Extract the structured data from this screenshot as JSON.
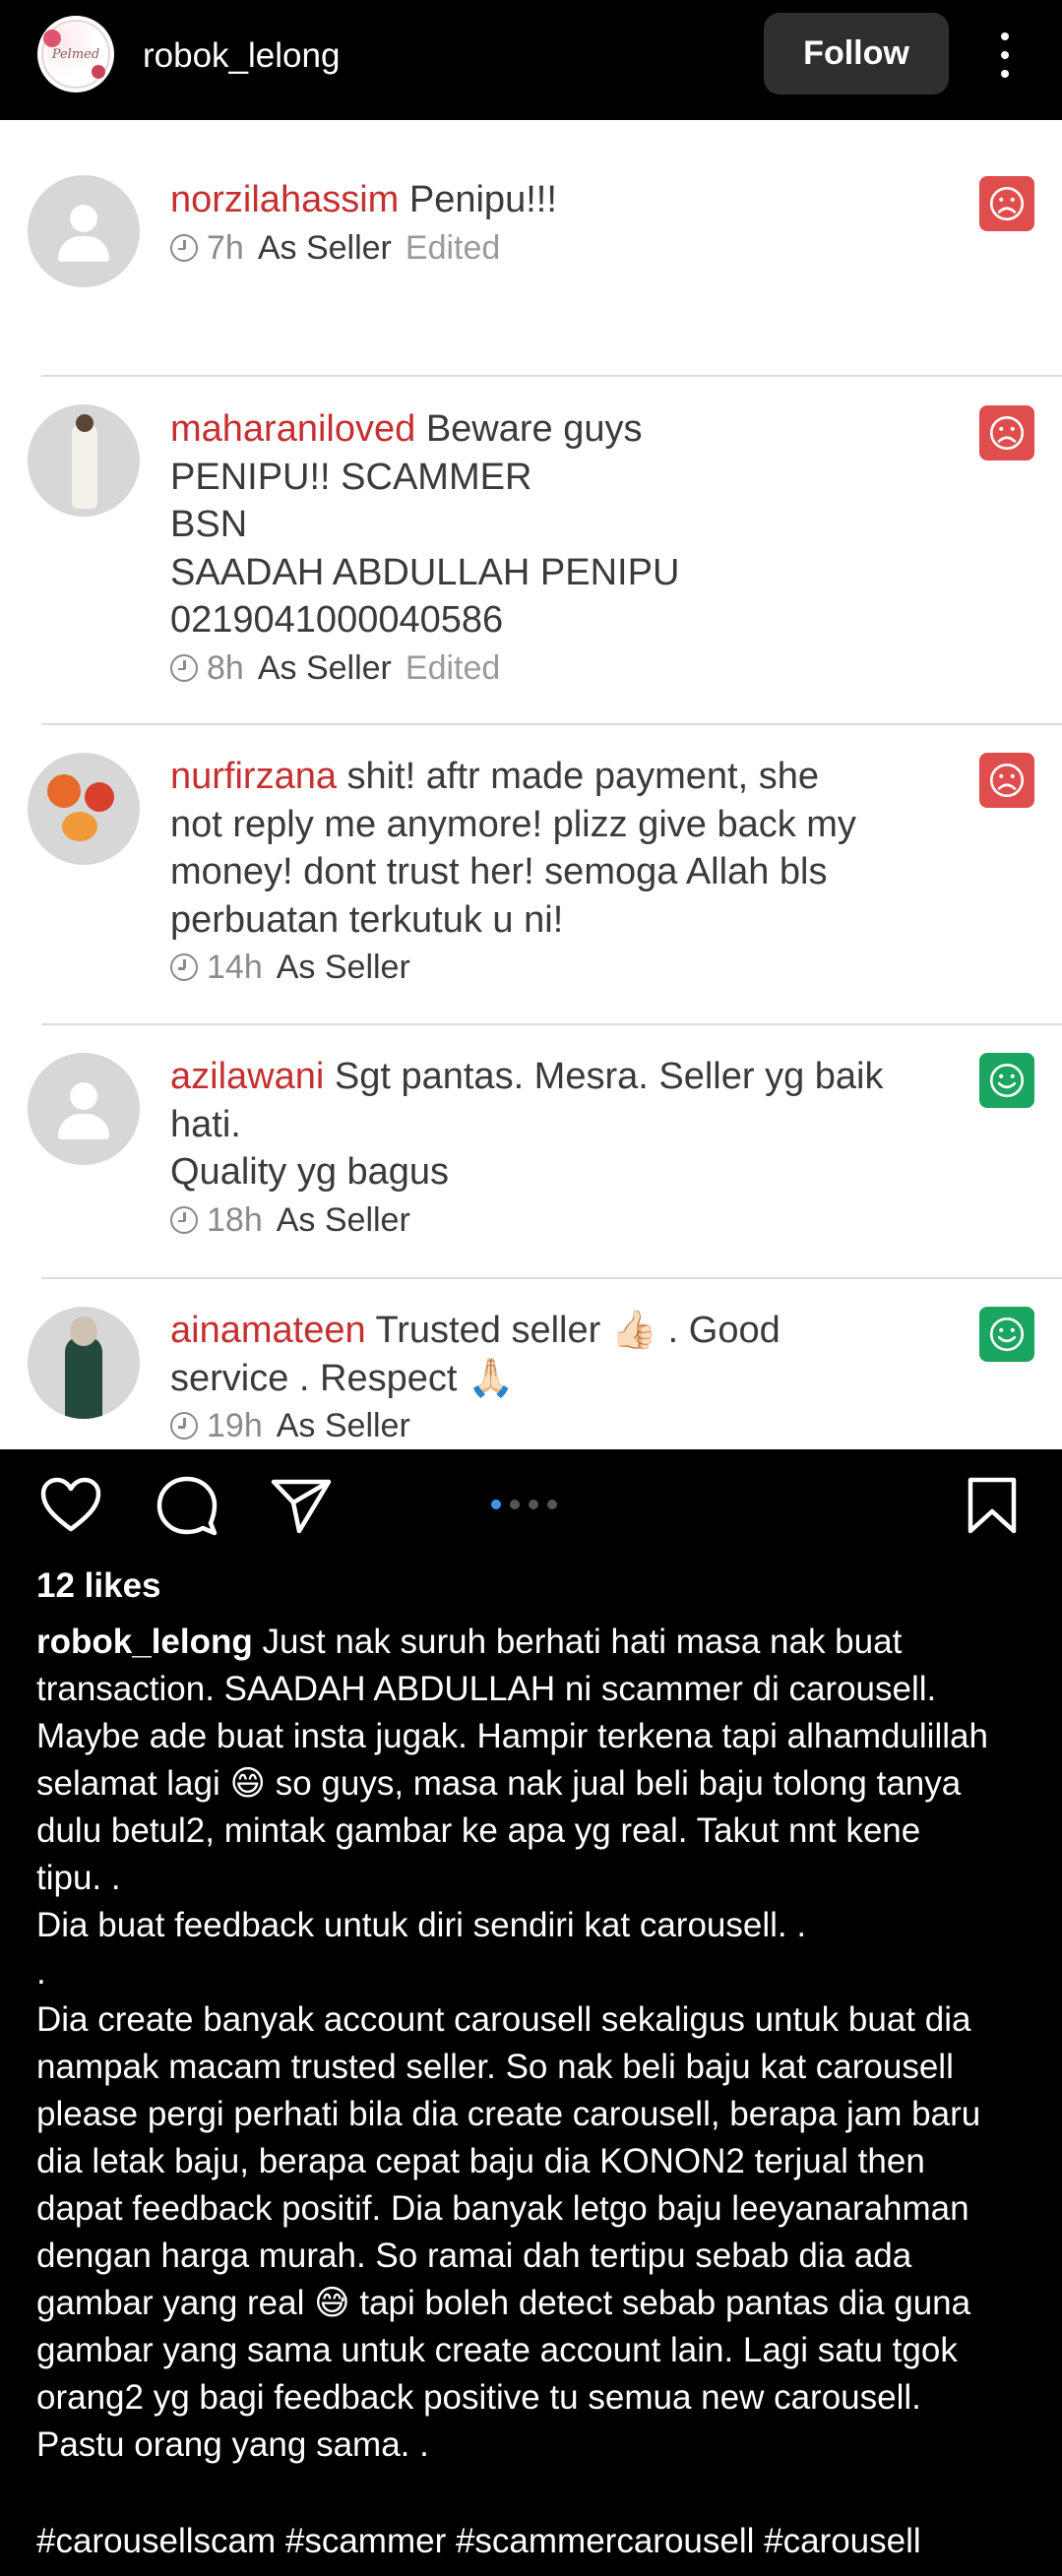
{
  "header": {
    "username": "robok_lelong",
    "follow_label": "Follow",
    "avatar_icon": "shop-logo-avatar",
    "avatar_text": "Pelmed",
    "more_icon": "more-vertical-icon"
  },
  "reviews": [
    {
      "username": "norzilahassim",
      "lines": [
        "Penipu!!!"
      ],
      "time": "7h",
      "role": "As Seller",
      "edited": "Edited",
      "rating": "negative",
      "avatar": "default-avatar"
    },
    {
      "username": "maharaniloved",
      "lines": [
        "Beware guys",
        "PENIPU!! SCAMMER",
        "BSN",
        "SAADAH ABDULLAH PENIPU",
        "0219041000040586"
      ],
      "time": "8h",
      "role": "As Seller",
      "edited": "Edited",
      "rating": "negative",
      "avatar": "photo-avatar"
    },
    {
      "username": "nurfirzana",
      "lines": [
        "shit! aftr made payment, she",
        "not reply me anymore! plizz give back my",
        "money! dont trust her! semoga Allah bls",
        "perbuatan terkutuk u ni!"
      ],
      "time": "14h",
      "role": "As Seller",
      "edited": "",
      "rating": "negative",
      "avatar": "photo-avatar"
    },
    {
      "username": "azilawani",
      "lines": [
        "Sgt pantas. Mesra. Seller yg baik",
        "hati.",
        "Quality yg bagus"
      ],
      "time": "18h",
      "role": "As Seller",
      "edited": "",
      "rating": "positive",
      "avatar": "default-avatar"
    },
    {
      "username": "ainamateen",
      "lines": [
        "Trusted seller 👍🏻 . Good",
        "service . Respect 🙏🏻"
      ],
      "time": "19h",
      "role": "As Seller",
      "edited": "",
      "rating": "positive",
      "avatar": "photo-avatar"
    }
  ],
  "actions": {
    "like_icon": "heart-icon",
    "comment_icon": "comment-icon",
    "share_icon": "send-icon",
    "save_icon": "bookmark-icon",
    "carousel_total": 4,
    "carousel_active": 1
  },
  "post": {
    "likes": "12 likes",
    "author": "robok_lelong",
    "caption_lines": [
      " Just nak suruh berhati hati masa nak buat",
      "transaction. SAADAH ABDULLAH ni scammer di carousell.",
      "Maybe ade buat insta jugak. Hampir terkena tapi alhamdulillah",
      "selamat lagi 😄 so guys, masa nak jual beli baju tolong tanya",
      "dulu betul2, mintak gambar ke apa yg real. Takut nnt kene",
      "tipu. .",
      "Dia buat feedback untuk diri sendiri kat carousell. .",
      ".",
      "Dia create banyak account carousell sekaligus untuk buat dia",
      "nampak macam trusted seller. So nak beli baju kat carousell",
      "please pergi perhati bila dia create carousell, berapa jam baru",
      "dia letak baju, berapa cepat baju dia KONON2 terjual then",
      "dapat feedback positif. Dia banyak letgo baju leeyanarahman",
      "dengan harga murah. So ramai dah tertipu sebab dia ada",
      "gambar yang real 😅 tapi boleh detect sebab pantas dia guna",
      "gambar yang sama untuk create account lain. Lagi satu tgok",
      "orang2 yg bagi feedback positive tu semua new carousell.",
      "Pastu orang yang sama. .",
      ""
    ],
    "hashtags": "#carousellscam #scammer #scammercarousell #carousell"
  },
  "colors": {
    "name_red": "#c62f2f",
    "negative": "#e04d4d",
    "positive": "#1aa560",
    "carousel_active": "#3897f0"
  }
}
